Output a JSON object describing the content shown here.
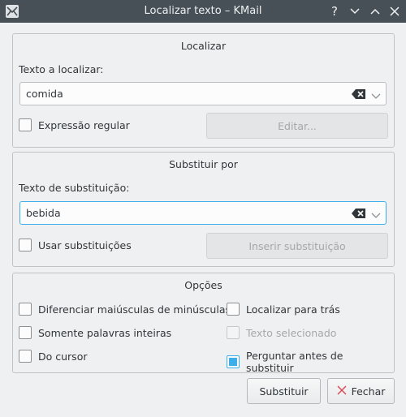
{
  "window": {
    "title": "Localizar texto – KMail"
  },
  "find": {
    "group_title": "Localizar",
    "label": "Texto a localizar:",
    "value": "comida",
    "regex_label": "Expressão regular",
    "regex_checked": false,
    "edit_button": "Editar..."
  },
  "replace": {
    "group_title": "Substituir por",
    "label": "Texto de substituição:",
    "value": "bebida",
    "placeholders_label": "Usar substituições",
    "placeholders_checked": false,
    "insert_button": "Inserir substituição"
  },
  "options": {
    "group_title": "Opções",
    "case_sensitive": "Diferenciar maiúsculas de minúsculas",
    "find_backwards": "Localizar para trás",
    "whole_words": "Somente palavras inteiras",
    "selected_text": "Texto selecionado",
    "from_cursor": "Do cursor",
    "prompt_on_replace": "Perguntar antes de substituir",
    "prompt_on_replace_checked": true
  },
  "footer": {
    "replace_button": "Substituir",
    "close_button": "Fechar"
  },
  "colors": {
    "accent": "#3daee9",
    "titlebar": "#475057",
    "close_icon": "#da4453"
  }
}
